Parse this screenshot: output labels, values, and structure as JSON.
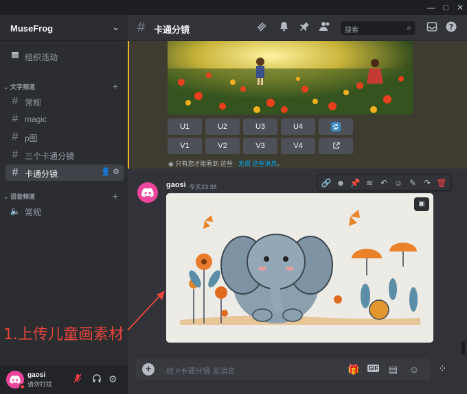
{
  "window": {
    "minimize": "—",
    "maximize": "□",
    "close": "✕"
  },
  "sidebar": {
    "server_name": "MuseFrog",
    "events_label": "组织活动",
    "text_category": "文字频道",
    "text_channels": [
      {
        "label": "常规"
      },
      {
        "label": "magic"
      },
      {
        "label": "p图"
      },
      {
        "label": "三个卡通分镜"
      },
      {
        "label": "卡通分镜"
      }
    ],
    "voice_category": "语音频道",
    "voice_channels": [
      {
        "label": "常规"
      }
    ]
  },
  "user": {
    "name": "gaosi",
    "status": "请勿打扰"
  },
  "header": {
    "channel_name": "卡通分镜",
    "search_placeholder": "搜索"
  },
  "mj_buttons": {
    "row1": [
      "U1",
      "U2",
      "U3",
      "U4"
    ],
    "row2": [
      "V1",
      "V2",
      "V3",
      "V4"
    ]
  },
  "ephemeral": {
    "text": "只有您才能看到 这些 · ",
    "dismiss": "无视 这些消息",
    "end": "。"
  },
  "message": {
    "author": "gaosi",
    "time": "今天23:38"
  },
  "composer": {
    "placeholder": "给 #卡通分镜 发消息"
  },
  "annotation": "1.上传儿童画素材",
  "colors": {
    "accent": "#eb459e",
    "highlight": "#f0b232",
    "annotation": "#e8453c",
    "link": "#00a8fc"
  }
}
